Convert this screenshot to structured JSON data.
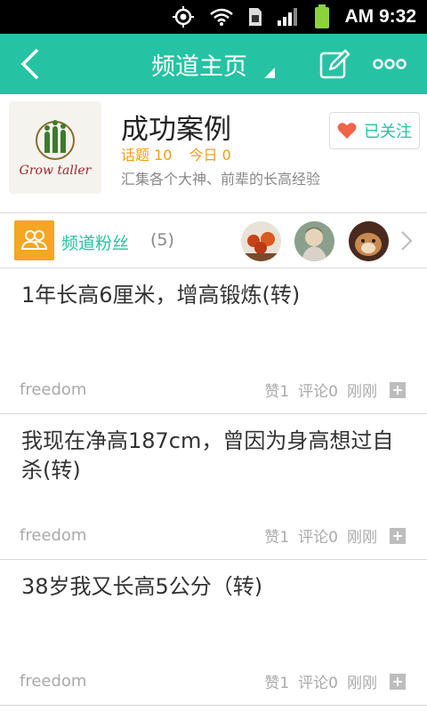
{
  "status": {
    "time": "AM 9:32"
  },
  "header": {
    "title": "频道主页"
  },
  "channel": {
    "name": "成功案例",
    "topics_label": "话题 10",
    "today_label": "今日 0",
    "description": "汇集各个大神、前辈的长高经验",
    "logo_text": "Grow taller",
    "follow_label": "已关注"
  },
  "fans": {
    "label": "频道粉丝",
    "count": "(5)"
  },
  "posts": [
    {
      "title": "1年长高6厘米，增高锻炼(转)",
      "author": "freedom",
      "likes": "赞1",
      "comments": "评论0",
      "time": "刚刚"
    },
    {
      "title": "我现在净高187cm，曾因为身高想过自杀(转)",
      "author": "freedom",
      "likes": "赞1",
      "comments": "评论0",
      "time": "刚刚"
    },
    {
      "title": "38岁我又长高5公分（转)",
      "author": "freedom",
      "likes": "赞1",
      "comments": "评论0",
      "time": "刚刚"
    }
  ],
  "colors": {
    "accent": "#25c3a3",
    "orange": "#f5a623"
  }
}
